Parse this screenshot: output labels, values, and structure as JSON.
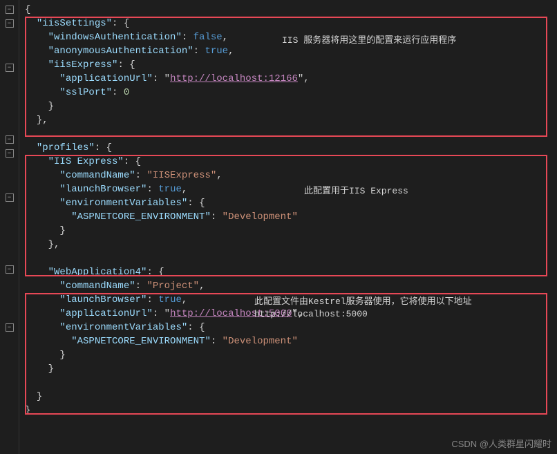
{
  "code": {
    "l1": "{",
    "l2_k": "\"iisSettings\"",
    "l2_p": ": {",
    "l3_k": "\"windowsAuthentication\"",
    "l3_v": "false",
    "l4_k": "\"anonymousAuthentication\"",
    "l4_v": "true",
    "l5_k": "\"iisExpress\"",
    "l5_p": ": {",
    "l6_k": "\"applicationUrl\"",
    "l6_v": "http://localhost:12166",
    "l7_k": "\"sslPort\"",
    "l7_v": "0",
    "l8": "}",
    "l9": "},",
    "l10_k": "\"profiles\"",
    "l10_p": ": {",
    "l11_k": "\"IIS Express\"",
    "l11_p": ": {",
    "l12_k": "\"commandName\"",
    "l12_v": "\"IISExpress\"",
    "l13_k": "\"launchBrowser\"",
    "l13_v": "true",
    "l14_k": "\"environmentVariables\"",
    "l14_p": ": {",
    "l15_k": "\"ASPNETCORE_ENVIRONMENT\"",
    "l15_v": "\"Development\"",
    "l16": "}",
    "l17": "},",
    "l18_k": "\"WebApplication4\"",
    "l18_p": ": {",
    "l19_k": "\"commandName\"",
    "l19_v": "\"Project\"",
    "l20_k": "\"launchBrowser\"",
    "l20_v": "true",
    "l21_k": "\"applicationUrl\"",
    "l21_v": "http://localhost:5000",
    "l22_k": "\"environmentVariables\"",
    "l22_p": ": {",
    "l23_k": "\"ASPNETCORE_ENVIRONMENT\"",
    "l23_v": "\"Development\"",
    "l24": "}",
    "l25": "}",
    "l26": "}",
    "l27": "}"
  },
  "annotations": {
    "a1": "IIS 服务器将用这里的配置来运行应用程序",
    "a2": "此配置用于IIS Express",
    "a3_line1": "此配置文件由Kestrel服务器使用，它将使用以下地址",
    "a3_line2": "http://localhost:5000"
  },
  "watermark": "CSDN @人类群星闪耀时",
  "gutter_icon": "−"
}
